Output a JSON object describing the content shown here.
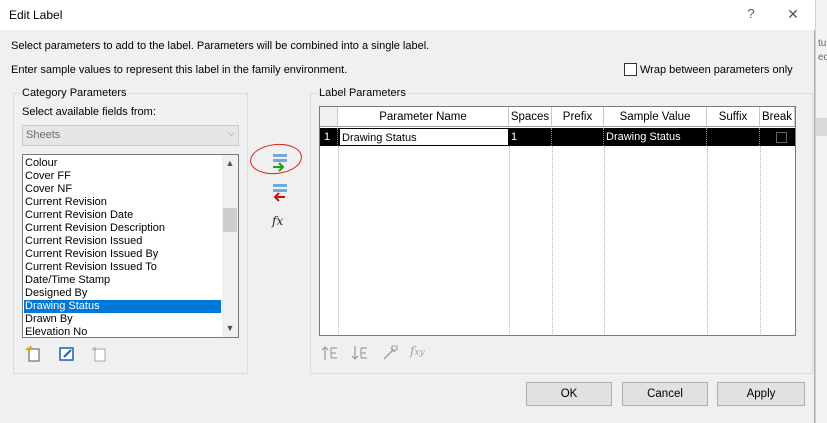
{
  "window": {
    "title": "Edit Label",
    "help": "?",
    "close": "✕"
  },
  "instructions": {
    "line1": "Select parameters to add to the label.  Parameters will be combined into a single label.",
    "line2": "Enter sample values to represent this label in the family environment."
  },
  "wrap_checkbox": {
    "label": "Wrap between parameters only",
    "checked": false
  },
  "category": {
    "legend": "Category Parameters",
    "select_label": "Select available fields from:",
    "selected_category": "Sheets",
    "fields": [
      "Colour",
      "Cover FF",
      "Cover NF",
      "Current Revision",
      "Current Revision Date",
      "Current Revision Description",
      "Current Revision Issued",
      "Current Revision Issued By",
      "Current Revision Issued To",
      "Date/Time Stamp",
      "Designed By",
      "Drawing Status",
      "Drawn By",
      "Elevation No"
    ],
    "selected_field": "Drawing Status",
    "icons": [
      "new-parameter-icon",
      "edit-parameter-icon",
      "delete-parameter-icon"
    ]
  },
  "middle_buttons": [
    "add-parameter-icon",
    "remove-parameter-icon",
    "fx-icon"
  ],
  "label_params": {
    "legend": "Label Parameters",
    "columns": [
      "Parameter Name",
      "Spaces",
      "Prefix",
      "Sample Value",
      "Suffix",
      "Break"
    ],
    "rows": [
      {
        "index": "1",
        "name": "Drawing Status",
        "spaces": "1",
        "prefix": "",
        "sample": "Drawing Status",
        "suffix": "",
        "break": false
      }
    ],
    "icons": [
      "move-up-icon",
      "move-down-icon",
      "edit-param-icon",
      "fx-param-icon"
    ]
  },
  "buttons": {
    "ok": "OK",
    "cancel": "Cancel",
    "apply": "Apply"
  },
  "background_fragments": [
    "tu",
    "ec"
  ],
  "colors": {
    "selection": "#0078d7",
    "annotation": "#e02020",
    "add_arrow": "#1aa31a",
    "remove_arrow": "#d01010"
  }
}
